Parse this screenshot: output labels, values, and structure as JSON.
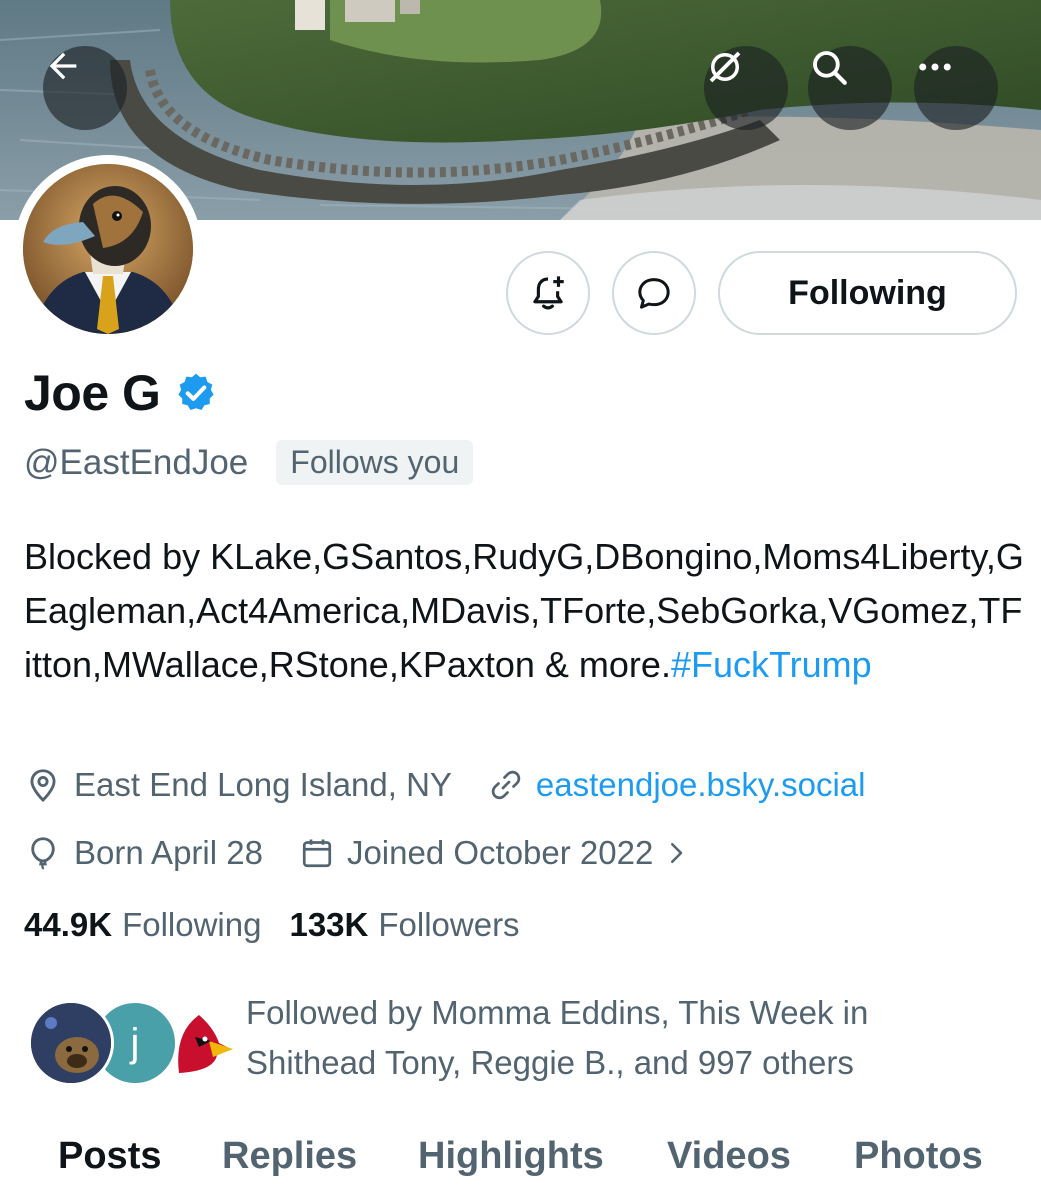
{
  "header": {
    "back_icon": "arrow-left-icon",
    "grok_icon": "grok-icon",
    "search_icon": "search-icon",
    "more_icon": "more-horizontal-icon"
  },
  "actions": {
    "notify_icon": "bell-plus-icon",
    "message_icon": "chat-bubble-icon",
    "following_label": "Following"
  },
  "profile": {
    "name": "Joe G",
    "verified": true,
    "handle": "@EastEndJoe",
    "follows_you": "Follows you",
    "bio_text": "Blocked by KLake,GSantos,RudyG,DBongino,Moms4Liberty,GEagleman,Act4America,MDavis,TForte,SebGorka,VGomez,TFitton,MWallace,RStone,KPaxton & more.",
    "bio_hashtag": "#FuckTrump",
    "location": "East End Long Island, NY",
    "website": "eastendjoe.bsky.social",
    "birthday": "Born April 28",
    "joined": "Joined October 2022"
  },
  "stats": {
    "following_count": "44.9K",
    "following_label": "Following",
    "followers_count": "133K",
    "followers_label": "Followers"
  },
  "followed_by": {
    "text": "Followed by Momma Eddins, This Week in Shithead Tony, Reggie B., and 997 others",
    "avatar_2_initial": "j"
  },
  "tabs": [
    "Posts",
    "Replies",
    "Highlights",
    "Videos",
    "Photos"
  ],
  "colors": {
    "accent": "#1d9bf0",
    "text_primary": "#0f1419",
    "text_secondary": "#536471",
    "border": "#cfd9de"
  }
}
